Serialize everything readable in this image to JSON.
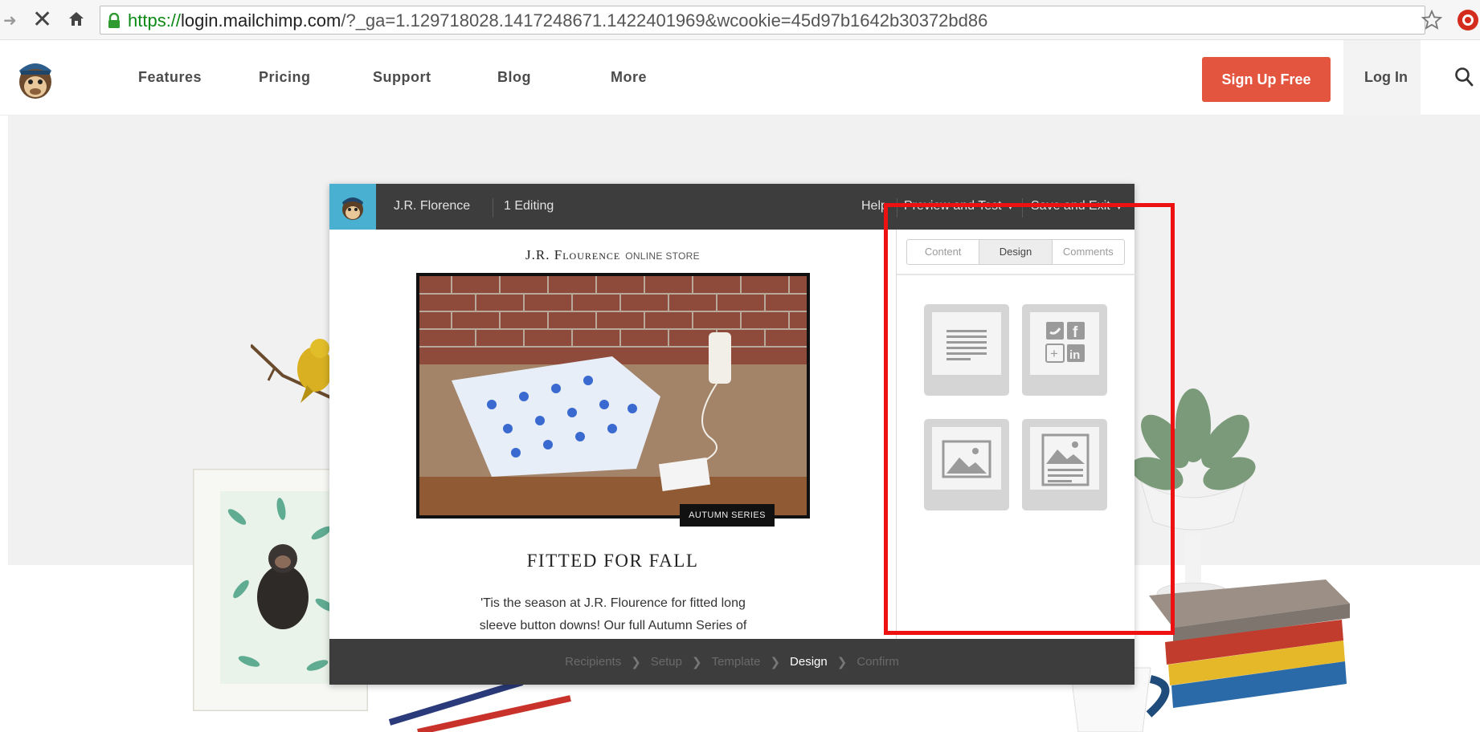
{
  "browser": {
    "url_protocol": "https://",
    "url_host": "login.mailchimp.com",
    "url_rest": "/?_ga=1.129718028.1417248671.1422401969&wcookie=45d97b1642b30372bd86"
  },
  "site_nav": {
    "links": [
      "Features",
      "Pricing",
      "Support",
      "Blog",
      "More"
    ],
    "signup_label": "Sign Up Free",
    "login_label": "Log In"
  },
  "app": {
    "account_name": "J.R. Florence",
    "editing_status": "1 Editing",
    "help_label": "Help",
    "preview_label": "Preview and Test",
    "save_label": "Save and Exit",
    "email": {
      "brand_name": "J.R. Flourence",
      "brand_sub": "ONLINE STORE",
      "tag": "AUTUMN SERIES",
      "heading": "FITTED FOR FALL",
      "body_line1": "'Tis the season at J.R. Flourence for fitted long",
      "body_line2": "sleeve button downs! Our full Autumn Series of"
    },
    "tabs": [
      "Content",
      "Design",
      "Comments"
    ],
    "active_tab": "Design",
    "blocks": [
      "text-block-icon",
      "social-block-icon",
      "image-block-icon",
      "image-card-block-icon"
    ],
    "steps": [
      "Recipients",
      "Setup",
      "Template",
      "Design",
      "Confirm"
    ],
    "active_step": "Design"
  },
  "colors": {
    "signup": "#e4553f",
    "app_bar": "#3d3d3d",
    "logo_box": "#4ab0d1",
    "highlight": "#ee1111"
  }
}
